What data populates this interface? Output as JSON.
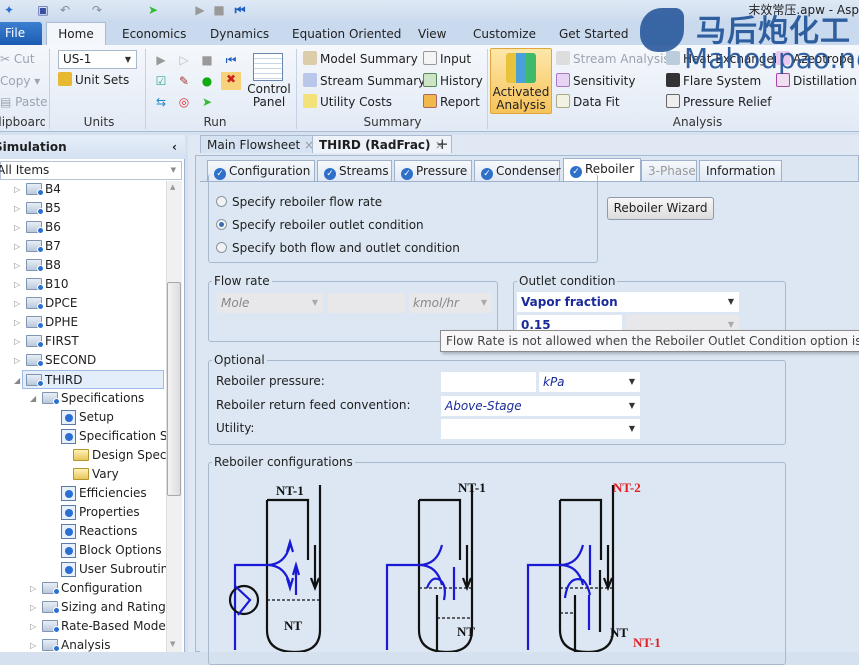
{
  "window": {
    "title": "末效常压.apw - Asp"
  },
  "watermark": {
    "cn": "马后炮化工",
    "en": "Mahoupao.net"
  },
  "ribbon": {
    "tabs": [
      "File",
      "Home",
      "Economics",
      "Dynamics",
      "Equation Oriented",
      "View",
      "Customize",
      "Get Started"
    ],
    "clipboard": {
      "cut": "Cut",
      "copy": "Copy",
      "paste": "Paste",
      "label": "Clipboard"
    },
    "units": {
      "value": "US-1",
      "unit_sets": "Unit Sets",
      "label": "Units"
    },
    "run": {
      "control_panel": "Control Panel",
      "label": "Run"
    },
    "summary": {
      "model_summary": "Model Summary",
      "stream_summary": "Stream Summary",
      "utility_costs": "Utility Costs",
      "input": "Input",
      "history": "History",
      "report": "Report",
      "label": "Summary"
    },
    "analysis": {
      "activated": "Activated Analysis",
      "stream_analysis": "Stream Analysis",
      "sensitivity": "Sensitivity",
      "data_fit": "Data Fit",
      "heat_exchanger": "Heat Exchanger",
      "flare_system": "Flare System",
      "pressure_relief": "Pressure Relief",
      "azeotrope": "Azeotrope Se",
      "distillation": "Distillation Sy",
      "label": "Analysis"
    }
  },
  "nav": {
    "header": "Simulation",
    "filter": "All Items",
    "blocks": [
      "B4",
      "B5",
      "B6",
      "B7",
      "B8",
      "B10",
      "DPCE",
      "DPHE",
      "FIRST",
      "SECOND",
      "THIRD"
    ],
    "specifications": "Specifications",
    "spec_items": [
      {
        "label": "Setup",
        "icon": "check"
      },
      {
        "label": "Specification Su",
        "icon": "check"
      },
      {
        "label": "Design Specifica",
        "icon": "folder"
      },
      {
        "label": "Vary",
        "icon": "folder"
      },
      {
        "label": "Efficiencies",
        "icon": "check"
      },
      {
        "label": "Properties",
        "icon": "check"
      },
      {
        "label": "Reactions",
        "icon": "check"
      },
      {
        "label": "Block Options",
        "icon": "check"
      },
      {
        "label": "User Subroutine",
        "icon": "check"
      }
    ],
    "sections": [
      "Configuration",
      "Sizing and Rating",
      "Rate-Based Modelin",
      "Analysis"
    ]
  },
  "doc_tabs": [
    "Main Flowsheet",
    "THIRD (RadFrac)"
  ],
  "form_tabs": [
    {
      "label": "Configuration",
      "ok": true
    },
    {
      "label": "Streams",
      "ok": true
    },
    {
      "label": "Pressure",
      "ok": true
    },
    {
      "label": "Condenser",
      "ok": true
    },
    {
      "label": "Reboiler",
      "ok": true,
      "active": true
    },
    {
      "label": "3-Phase",
      "ok": false
    },
    {
      "label": "Information",
      "ok": false
    }
  ],
  "form": {
    "radios": [
      "Specify reboiler flow rate",
      "Specify reboiler outlet condition",
      "Specify both flow and outlet condition"
    ],
    "selected_radio": 1,
    "wizard": "Reboiler Wizard",
    "flow_rate": {
      "legend": "Flow rate",
      "basis": "Mole",
      "value": "",
      "units": "kmol/hr"
    },
    "outlet": {
      "legend": "Outlet condition",
      "spec": "Vapor fraction",
      "value": "0.15"
    },
    "tooltip": "Flow Rate is not allowed when the Reboiler Outlet Condition option is s",
    "optional": {
      "legend": "Optional",
      "pressure_label": "Reboiler pressure:",
      "pressure_value": "",
      "pressure_units": "kPa",
      "return_label": "Reboiler return feed convention:",
      "return_value": "Above-Stage",
      "utility_label": "Utility:",
      "utility_value": ""
    },
    "configs": {
      "legend": "Reboiler configurations",
      "d1": {
        "top": "NT-1",
        "bottom": "NT"
      },
      "d2": {
        "top": "NT-1",
        "bottom": "NT"
      },
      "d3": {
        "top": "NT-2",
        "bottom": "NT",
        "side": "NT-1"
      }
    }
  },
  "colors": {
    "accent": "#1b5cb3",
    "flow_blue": "#1a1ad6",
    "red_label": "#e02020"
  }
}
